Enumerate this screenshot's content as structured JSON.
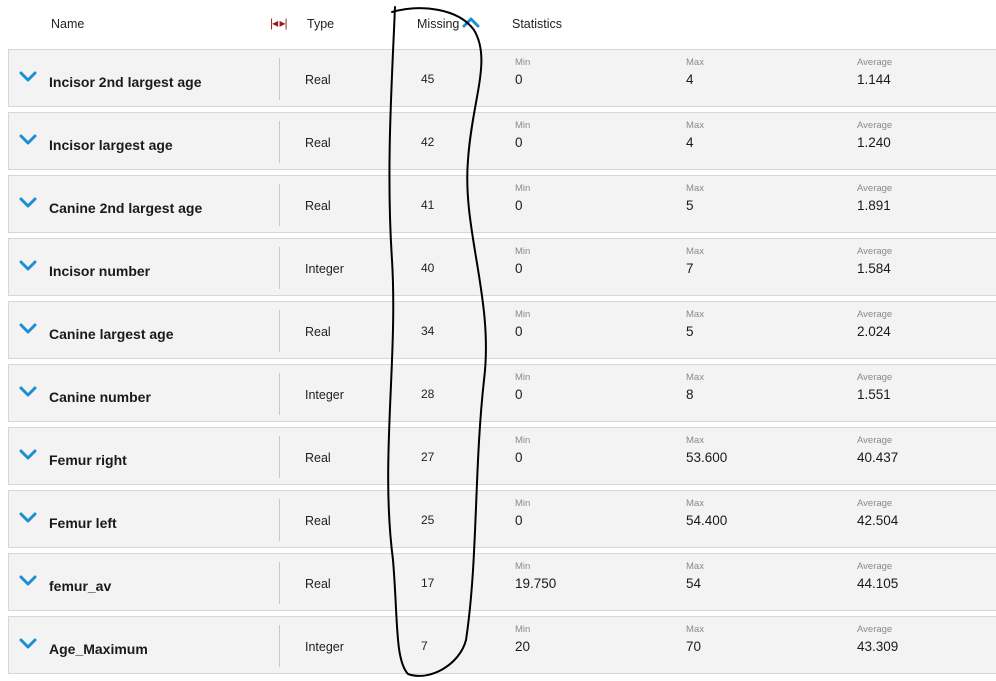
{
  "header": {
    "name": "Name",
    "type": "Type",
    "missing": "Missing",
    "statistics": "Statistics"
  },
  "stat_labels": {
    "min": "Min",
    "max": "Max",
    "average": "Average"
  },
  "colors": {
    "accent": "#1b8fd1",
    "row_bg": "#f3f3f3",
    "annotation": "#000000"
  },
  "sort": {
    "column": "Missing",
    "direction": "descending",
    "icon": "chevron-up-icon"
  },
  "rows": [
    {
      "name": "Incisor 2nd largest age",
      "type": "Real",
      "missing": "45",
      "min": "0",
      "max": "4",
      "average": "1.144"
    },
    {
      "name": "Incisor largest age",
      "type": "Real",
      "missing": "42",
      "min": "0",
      "max": "4",
      "average": "1.240"
    },
    {
      "name": "Canine 2nd largest age",
      "type": "Real",
      "missing": "41",
      "min": "0",
      "max": "5",
      "average": "1.891"
    },
    {
      "name": "Incisor number",
      "type": "Integer",
      "missing": "40",
      "min": "0",
      "max": "7",
      "average": "1.584"
    },
    {
      "name": "Canine largest age",
      "type": "Real",
      "missing": "34",
      "min": "0",
      "max": "5",
      "average": "2.024"
    },
    {
      "name": "Canine number",
      "type": "Integer",
      "missing": "28",
      "min": "0",
      "max": "8",
      "average": "1.551"
    },
    {
      "name": "Femur right",
      "type": "Real",
      "missing": "27",
      "min": "0",
      "max": "53.600",
      "average": "40.437"
    },
    {
      "name": "Femur left",
      "type": "Real",
      "missing": "25",
      "min": "0",
      "max": "54.400",
      "average": "42.504"
    },
    {
      "name": "femur_av",
      "type": "Real",
      "missing": "17",
      "min": "19.750",
      "max": "54",
      "average": "44.105"
    },
    {
      "name": "Age_Maximum",
      "type": "Integer",
      "missing": "7",
      "min": "20",
      "max": "70",
      "average": "43.309"
    }
  ]
}
